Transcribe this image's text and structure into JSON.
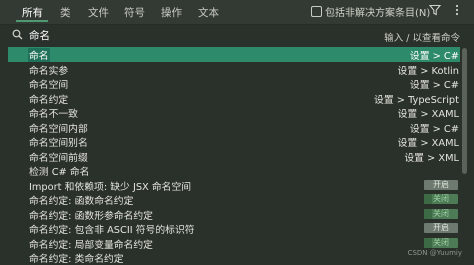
{
  "tabs": [
    {
      "label": "所有"
    },
    {
      "label": "类"
    },
    {
      "label": "文件"
    },
    {
      "label": "符号"
    },
    {
      "label": "操作"
    },
    {
      "label": "文本"
    }
  ],
  "filter": {
    "label": "包括非解决方案条目(N)",
    "checked": false
  },
  "icons": [
    "funnel-icon",
    "more-icon"
  ],
  "search": {
    "value": "命名",
    "hint": "输入 / 以查看命令"
  },
  "results": [
    {
      "name": "命名",
      "path": "设置 > C#",
      "selected": true
    },
    {
      "name": "命名实参",
      "path": "设置 > Kotlin"
    },
    {
      "name": "命名空间",
      "path": "设置 > C#"
    },
    {
      "name": "命名约定",
      "path": "设置 > TypeScript"
    },
    {
      "name": "命名不一致",
      "path": "设置 > XAML"
    },
    {
      "name": "命名空间内部",
      "path": "设置 > C#"
    },
    {
      "name": "命名空间别名",
      "path": "设置 > XAML"
    },
    {
      "name": "命名空间前缀",
      "path": "设置 > XML"
    },
    {
      "name": "检测 C# 命名",
      "path": ""
    },
    {
      "name": "Import 和依赖项: 缺少 JSX 命名空间",
      "toggle": "开启",
      "toggle_on": true
    },
    {
      "name": "命名约定: 函数命名约定",
      "toggle": "关闭",
      "toggle_on": false
    },
    {
      "name": "命名约定: 函数形参命名约定",
      "toggle": "关闭",
      "toggle_on": false
    },
    {
      "name": "命名约定: 包含非 ASCII 符号的标识符",
      "toggle": "开启",
      "toggle_on": true
    },
    {
      "name": "命名约定: 局部变量命名约定",
      "toggle": "关闭",
      "toggle_on": false
    },
    {
      "name": "命名约定: 类命名约定",
      "toggle": "",
      "toggle_on": false
    }
  ],
  "watermark": "CSDN @Yuumiy",
  "colors": {
    "background": "#2a302a",
    "selection": "#2d8a6b",
    "tab_underline": "#4f9a73"
  }
}
